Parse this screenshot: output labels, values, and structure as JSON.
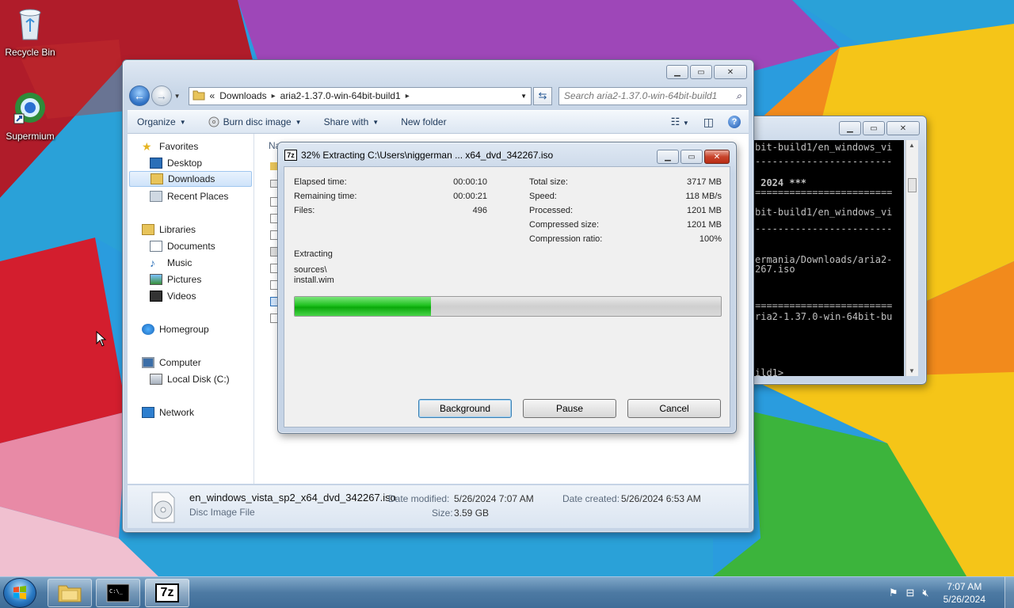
{
  "desktop": {
    "icons": [
      {
        "label": "Recycle Bin",
        "icon": "recycle-bin-icon"
      },
      {
        "label": "Supermium",
        "icon": "supermium-icon"
      }
    ]
  },
  "explorer": {
    "address": {
      "prefix": "«",
      "crumbs": [
        "Downloads",
        "aria2-1.37.0-win-64bit-build1"
      ]
    },
    "search_placeholder": "Search aria2-1.37.0-win-64bit-build1",
    "toolbar": {
      "organize": "Organize",
      "burn": "Burn disc image",
      "share": "Share with",
      "new_folder": "New folder"
    },
    "nav": {
      "favorites": "Favorites",
      "desktop": "Desktop",
      "downloads": "Downloads",
      "recent": "Recent Places",
      "libraries": "Libraries",
      "documents": "Documents",
      "music": "Music",
      "pictures": "Pictures",
      "videos": "Videos",
      "homegroup": "Homegroup",
      "computer": "Computer",
      "local_disk": "Local Disk (C:)",
      "network": "Network"
    },
    "column_header_fragment": "Na",
    "details": {
      "filename": "en_windows_vista_sp2_x64_dvd_342267.iso",
      "filetype": "Disc Image File",
      "modified_label": "Date modified:",
      "modified_value": "5/26/2024 7:07 AM",
      "created_label": "Date created:",
      "created_value": "5/26/2024 6:53 AM",
      "size_label": "Size:",
      "size_value": "3.59 GB"
    }
  },
  "zip_dialog": {
    "title": "32% Extracting C:\\Users\\niggerman ... x64_dvd_342267.iso",
    "elapsed_label": "Elapsed time:",
    "elapsed_value": "00:00:10",
    "remaining_label": "Remaining time:",
    "remaining_value": "00:00:21",
    "files_label": "Files:",
    "files_value": "496",
    "total_label": "Total size:",
    "total_value": "3717 MB",
    "speed_label": "Speed:",
    "speed_value": "118 MB/s",
    "processed_label": "Processed:",
    "processed_value": "1201 MB",
    "compressed_label": "Compressed size:",
    "compressed_value": "1201 MB",
    "ratio_label": "Compression ratio:",
    "ratio_value": "100%",
    "status": "Extracting",
    "path_line1": "sources\\",
    "path_line2": "install.wim",
    "progress_percent": 32,
    "buttons": {
      "background": "Background",
      "pause": "Pause",
      "cancel": "Cancel"
    }
  },
  "console": {
    "lines": [
      "bit-build1/en_windows_vi",
      "------------------------",
      " 2024 ***",
      "========================",
      "bit-build1/en_windows_vi",
      "------------------------",
      "ermania/Downloads/aria2-",
      "267.iso",
      "========================",
      "ria2-1.37.0-win-64bit-bu",
      "ild1>"
    ]
  },
  "taskbar": {
    "time": "7:07 AM",
    "date": "5/26/2024",
    "apps": [
      "explorer-icon",
      "cmd-icon",
      "7zip-icon"
    ],
    "app_7z_label": "7z"
  },
  "colors": {
    "progress_green": "#1fc11f",
    "aero_blue": "#c6d4e6",
    "taskbar": "#4d7aa3"
  }
}
